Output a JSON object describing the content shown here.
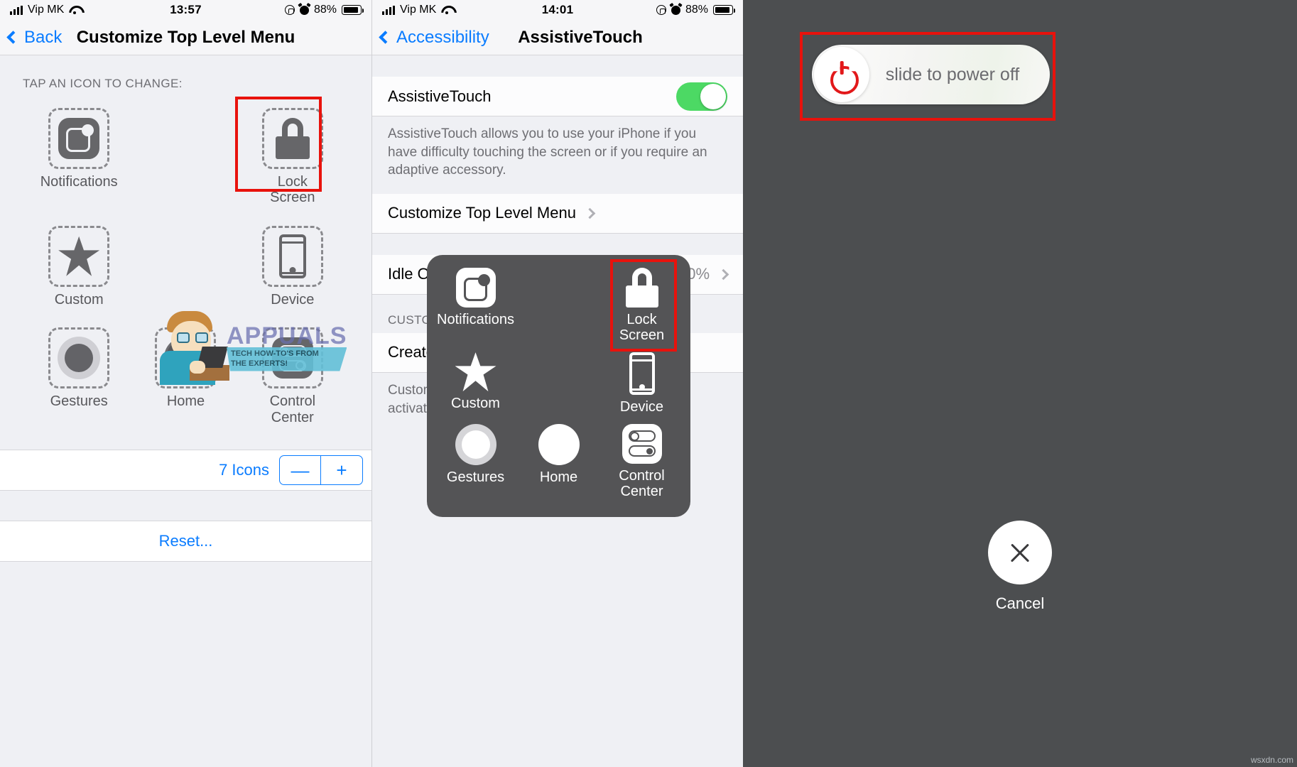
{
  "panels": {
    "left": {
      "status": {
        "carrier": "Vip MK",
        "time": "13:57",
        "battery": "88%"
      },
      "nav": {
        "back": "Back",
        "title": "Customize Top Level Menu"
      },
      "section_label": "TAP AN ICON TO CHANGE:",
      "icons": [
        {
          "label": "Notifications",
          "icon": "notifications-icon",
          "highlighted": false
        },
        {
          "label": "",
          "icon": "empty-slot",
          "highlighted": false
        },
        {
          "label": "Lock\nScreen",
          "label_line1": "Lock",
          "label_line2": "Screen",
          "icon": "lock-icon",
          "highlighted": true
        },
        {
          "label": "Custom",
          "icon": "star-icon",
          "highlighted": false
        },
        {
          "label": "",
          "icon": "empty-slot",
          "highlighted": false
        },
        {
          "label": "Device",
          "icon": "device-icon",
          "highlighted": false
        },
        {
          "label": "Gestures",
          "icon": "gestures-icon",
          "highlighted": false
        },
        {
          "label": "Home",
          "icon": "home-icon",
          "highlighted": false
        },
        {
          "label": "Control\nCenter",
          "label_line1": "Control",
          "label_line2": "Center",
          "icon": "control-center-icon",
          "highlighted": false
        }
      ],
      "count_row": {
        "label": "7 Icons",
        "minus": "—",
        "plus": "+"
      },
      "reset": "Reset..."
    },
    "mid": {
      "status": {
        "carrier": "Vip MK",
        "time": "14:01",
        "battery": "88%"
      },
      "nav": {
        "back": "Accessibility",
        "title": "AssistiveTouch"
      },
      "rows": {
        "assistivetouch_label": "AssistiveTouch",
        "assistivetouch_footnote": "AssistiveTouch allows you to use your iPhone if you have difficulty touching the screen or if you require an adaptive accessory.",
        "customize_menu": "Customize Top Level Menu",
        "idle_opacity_label": "Idle O",
        "idle_opacity_value": "0%",
        "custom_actions_head": "CUSTO",
        "create_label": "Create",
        "custom_note_line1": "Custom",
        "custom_note_line2": "activate"
      },
      "overlay_menu": [
        {
          "label": "Notifications",
          "icon": "notifications-icon",
          "highlighted": false
        },
        {
          "label": "",
          "icon": "empty-slot",
          "highlighted": false
        },
        {
          "label_line1": "Lock",
          "label_line2": "Screen",
          "icon": "lock-icon",
          "highlighted": true
        },
        {
          "label": "Custom",
          "icon": "star-icon",
          "highlighted": false
        },
        {
          "label": "",
          "icon": "empty-slot",
          "highlighted": false
        },
        {
          "label": "Device",
          "icon": "device-icon",
          "highlighted": false
        },
        {
          "label": "Gestures",
          "icon": "gestures-icon",
          "highlighted": false
        },
        {
          "label": "Home",
          "icon": "home-icon",
          "highlighted": false
        },
        {
          "label_line1": "Control",
          "label_line2": "Center",
          "icon": "control-center-icon",
          "highlighted": false
        }
      ]
    },
    "right": {
      "slider_text": "slide to power off",
      "power_icon": "power-icon",
      "cancel_label": "Cancel",
      "cancel_icon": "close-icon"
    }
  },
  "watermark": {
    "brand": "APPUALS",
    "tagline_line1": "TECH HOW-TO'S FROM",
    "tagline_line2": "THE EXPERTS!"
  },
  "credit": "wsxdn.com",
  "colors": {
    "ios_blue": "#0a7cff",
    "highlight_red": "#e8120c",
    "toggle_green": "#4cd964",
    "power_red": "#e2181a"
  }
}
